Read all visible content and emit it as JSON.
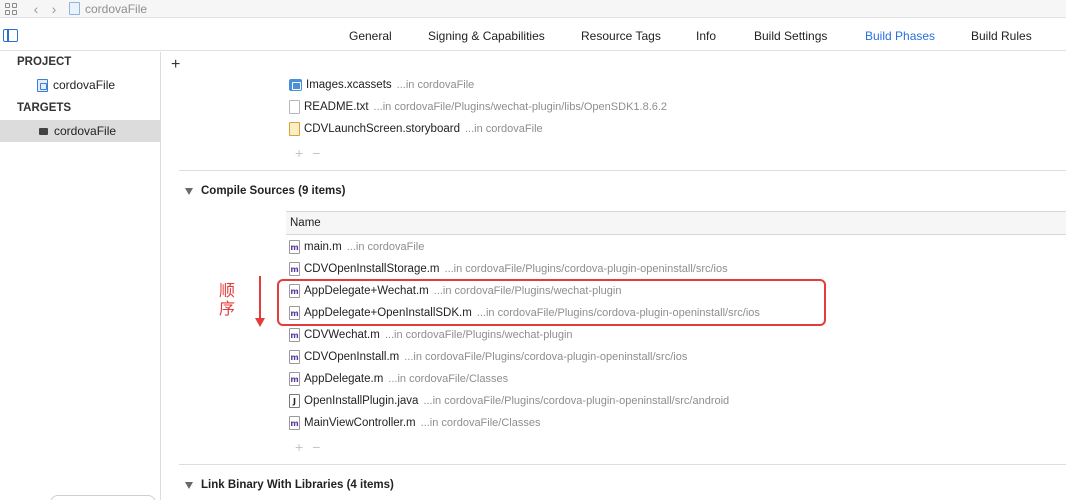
{
  "jumpbar": {
    "project_name": "cordovaFile"
  },
  "tabs": [
    {
      "label": "General",
      "active": false
    },
    {
      "label": "Signing & Capabilities",
      "active": false
    },
    {
      "label": "Resource Tags",
      "active": false
    },
    {
      "label": "Info",
      "active": false
    },
    {
      "label": "Build Settings",
      "active": false
    },
    {
      "label": "Build Phases",
      "active": true
    },
    {
      "label": "Build Rules",
      "active": false
    }
  ],
  "sidebar": {
    "project_header": "PROJECT",
    "project_item": "cordovaFile",
    "targets_header": "TARGETS",
    "target_item": "cordovaFile"
  },
  "copy_resources": {
    "files": [
      {
        "name": "Images.xcassets",
        "path": "...in cordovaFile",
        "icon": "xcassets-icon"
      },
      {
        "name": "README.txt",
        "path": "...in cordovaFile/Plugins/wechat-plugin/libs/OpenSDK1.8.6.2",
        "icon": "text-file-icon"
      },
      {
        "name": "CDVLaunchScreen.storyboard",
        "path": "...in cordovaFile",
        "icon": "storyboard-icon"
      }
    ]
  },
  "compile_sources": {
    "title": "Compile Sources (9 items)",
    "column_name": "Name",
    "files": [
      {
        "name": "main.m",
        "path": "...in cordovaFile",
        "icon": "m"
      },
      {
        "name": "CDVOpenInstallStorage.m",
        "path": "...in cordovaFile/Plugins/cordova-plugin-openinstall/src/ios",
        "icon": "m"
      },
      {
        "name": "AppDelegate+Wechat.m",
        "path": "...in cordovaFile/Plugins/wechat-plugin",
        "icon": "m"
      },
      {
        "name": "AppDelegate+OpenInstallSDK.m",
        "path": "...in cordovaFile/Plugins/cordova-plugin-openinstall/src/ios",
        "icon": "m"
      },
      {
        "name": "CDVWechat.m",
        "path": "...in cordovaFile/Plugins/wechat-plugin",
        "icon": "m"
      },
      {
        "name": "CDVOpenInstall.m",
        "path": "...in cordovaFile/Plugins/cordova-plugin-openinstall/src/ios",
        "icon": "m"
      },
      {
        "name": "AppDelegate.m",
        "path": "...in cordovaFile/Classes",
        "icon": "m"
      },
      {
        "name": "OpenInstallPlugin.java",
        "path": "...in cordovaFile/Plugins/cordova-plugin-openinstall/src/android",
        "icon": "J"
      },
      {
        "name": "MainViewController.m",
        "path": "...in cordovaFile/Classes",
        "icon": "m"
      }
    ]
  },
  "link_binary": {
    "title": "Link Binary With Libraries (4 items)"
  },
  "controls": {
    "add": "+",
    "remove": "−"
  },
  "annotation": {
    "text": "顺序",
    "color": "#e23c3c"
  },
  "colors": {
    "accent": "#2a6fdb",
    "annotation": "#e23c3c"
  }
}
